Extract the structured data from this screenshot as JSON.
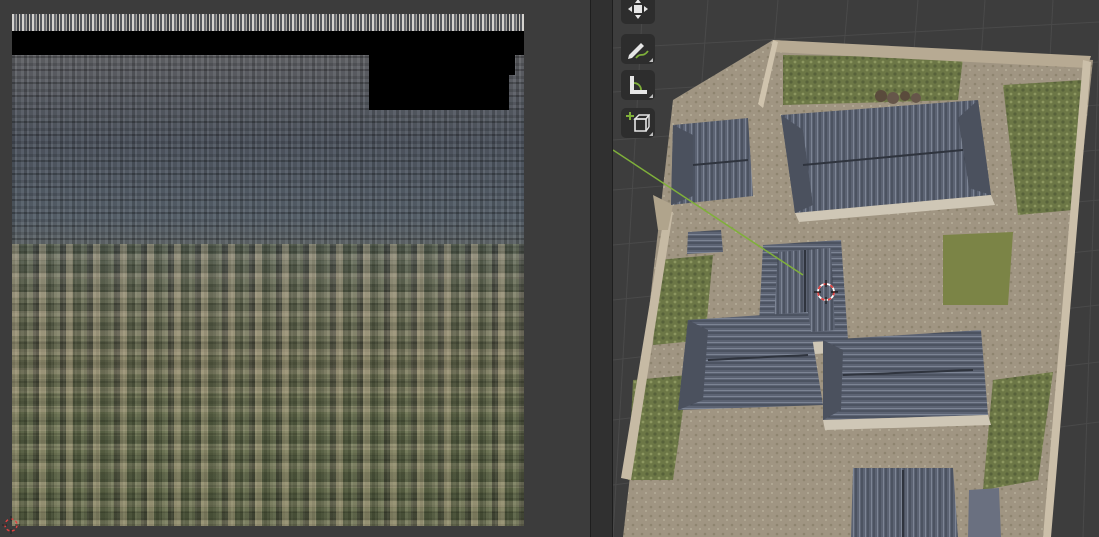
{
  "uv_editor": {
    "texture_icon": "baked-texture-atlas"
  },
  "viewport": {
    "model_icon": "hanok-courtyard-scan",
    "cursor_icon": "3d-cursor-icon"
  },
  "toolbar": {
    "tools": [
      {
        "name": "transform",
        "icon": "transform-icon"
      },
      {
        "name": "annotate",
        "icon": "annotate-pencil-icon"
      },
      {
        "name": "measure",
        "icon": "measure-ruler-icon"
      },
      {
        "name": "add-cube",
        "icon": "add-cube-icon"
      }
    ]
  },
  "colors": {
    "uv_background": "#3c3c3c",
    "viewport_background": "#3d3d3d",
    "tool_background": "#2d2d2d",
    "roof": "#5b6170",
    "ground": "#9c927c",
    "grass": "#6d7a45",
    "axis_green": "#7fb03a",
    "cursor_red": "#e04040"
  }
}
